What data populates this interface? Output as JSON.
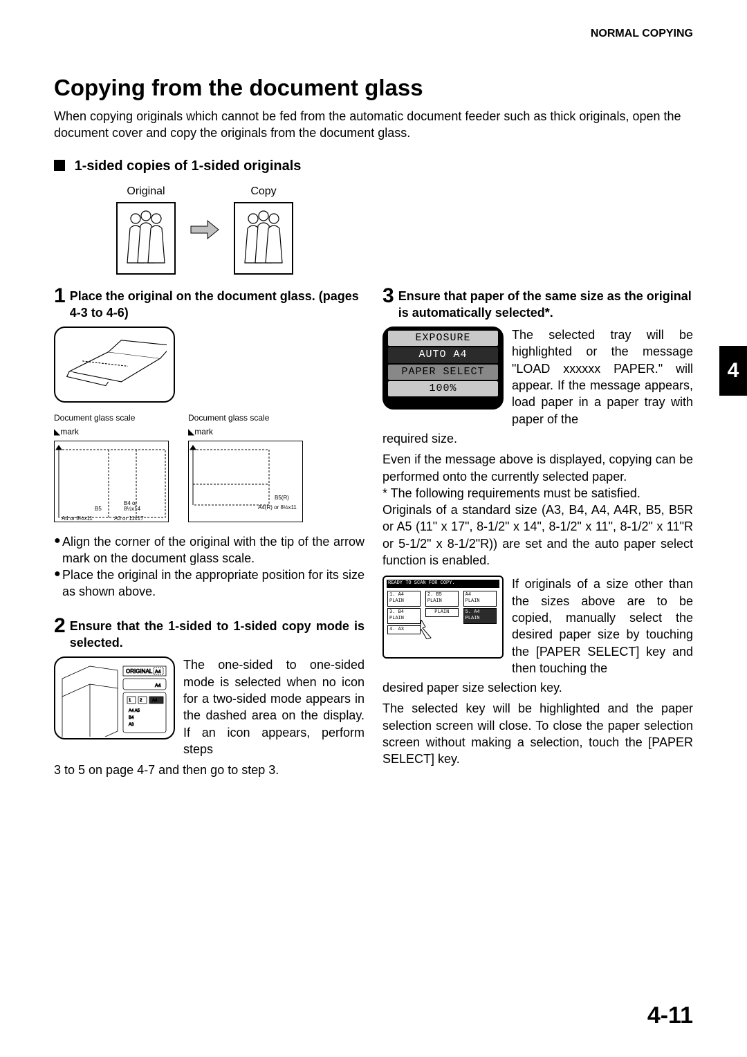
{
  "header": {
    "label": "NORMAL COPYING"
  },
  "title": "Copying from the document glass",
  "intro": "When copying originals which cannot be fed from the automatic document feeder such as thick originals, open the document cover and copy the originals from the document glass.",
  "subheading": "1-sided copies of 1-sided originals",
  "origcopy": {
    "original": "Original",
    "copy": "Copy"
  },
  "chapter_tab": "4",
  "page_number": "4-11",
  "step1": {
    "num": "1",
    "title": "Place the original on the document glass. (pages 4-3 to 4-6)",
    "glass_scale_label": "Document glass scale",
    "mark_label": "mark",
    "diag1_labels": [
      "B4 or 8½x14",
      "B5",
      "A4 or 8½x11",
      "A3 or 11x17"
    ],
    "diag2_labels": [
      "B5(R)",
      "A4(R) or 8½x11"
    ],
    "bullet1": "Align the corner of the original with the tip of the arrow mark      on the document glass scale.",
    "bullet2": "Place the original in the appropriate position for its size as shown above."
  },
  "step2": {
    "num": "2",
    "title": "Ensure that the 1-sided to 1-sided copy mode is selected.",
    "panel": {
      "original": "ORIGINAL",
      "size": "A4",
      "trays": [
        "A4",
        "A5",
        "B4",
        "A3"
      ],
      "sel": "A4"
    },
    "body": "The one-sided to one-sided mode is selected when no icon for a two-sided mode appears in the dashed area on the display. If an icon appears, perform steps",
    "tail": "3 to 5 on page 4-7 and then go to step 3."
  },
  "step3": {
    "num": "3",
    "title": "Ensure that paper of the same size as the original is automatically selected*.",
    "lcd": {
      "r1": "EXPOSURE",
      "r2": "AUTO  A4",
      "r3": "PAPER SELECT",
      "r4": "100%"
    },
    "body1": "The selected tray will be highlighted or the message \"LOAD xxxxxx PAPER.\" will appear. If the message appears, load paper in a paper tray with paper of the",
    "tail1": "required size.",
    "para2": "Even if the message above is displayed, copying can be performed onto the currently selected paper.",
    "para3": "* The following requirements must be satisfied.",
    "para4": "Originals of a standard size (A3, B4, A4, A4R, B5, B5R or A5 (11\" x 17\", 8-1/2\" x 14\", 8-1/2\" x 11\", 8-1/2\" x 11\"R or 5-1/2\" x 8-1/2\"R)) are set and the auto paper select function is enabled.",
    "panel2": {
      "top": "READY TO SCAN FOR COPY.",
      "items": [
        "1. A4",
        "2. B5",
        "A4",
        "3. B4",
        "5. A4",
        "4. A3"
      ],
      "plain": "PLAIN"
    },
    "body2": "If originals of a size other than the sizes above are to be copied, manually select the desired paper size by touching the [PAPER SELECT] key and then touching the",
    "tail2": "desired paper size selection key.",
    "para5": "The selected key will be highlighted and the paper selection screen will close. To close the paper selection screen without making a selection, touch the [PAPER SELECT] key."
  }
}
